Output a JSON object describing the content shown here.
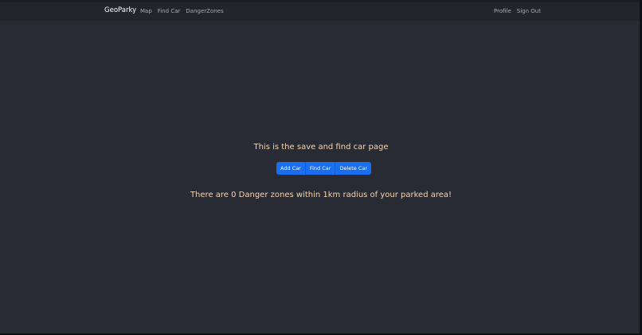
{
  "navbar": {
    "brand": "GeoParky",
    "left_links": [
      "Map",
      "Find Car",
      "DangerZones"
    ],
    "right_links": [
      "Profile",
      "Sign Out"
    ]
  },
  "main": {
    "heading": "This is the save and find car page",
    "buttons": [
      "Add Car",
      "Find Car",
      "Delete Car"
    ],
    "danger_message": "There are 0 Danger zones within 1km radius of your parked area!"
  },
  "colors": {
    "background": "#282b34",
    "navbar": "#22252c",
    "accent_text": "#f2d5b3",
    "button": "#1a6ef0"
  }
}
